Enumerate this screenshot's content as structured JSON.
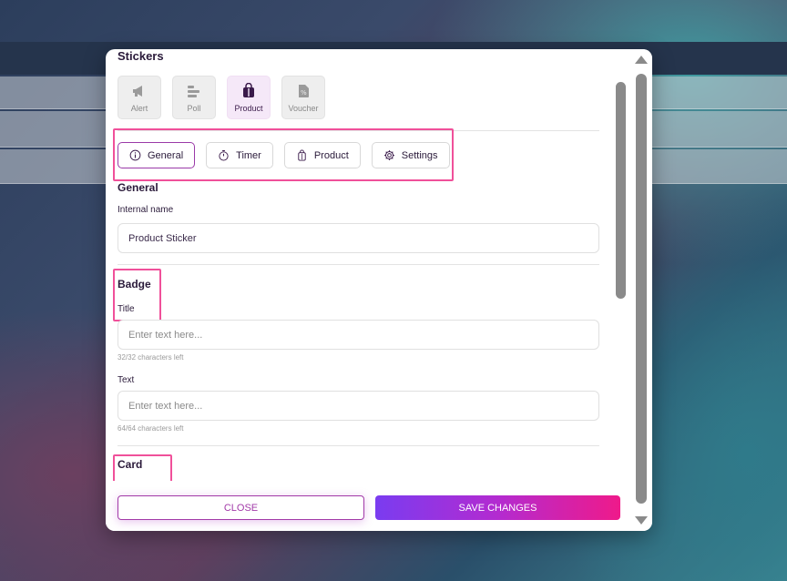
{
  "dialog": {
    "title": "Stickers"
  },
  "sticker_types": [
    {
      "label": "Alert",
      "icon": "megaphone-icon"
    },
    {
      "label": "Poll",
      "icon": "poll-bars-icon"
    },
    {
      "label": "Product",
      "icon": "shopping-bag-icon",
      "active": true
    },
    {
      "label": "Voucher",
      "icon": "voucher-icon"
    }
  ],
  "tabs": [
    {
      "label": "General",
      "icon": "info-icon",
      "active": true
    },
    {
      "label": "Timer",
      "icon": "stopwatch-icon"
    },
    {
      "label": "Product",
      "icon": "product-bag-icon"
    },
    {
      "label": "Settings",
      "icon": "gear-icon"
    }
  ],
  "general": {
    "heading": "General",
    "internal_name_label": "Internal name",
    "internal_name_value": "Product Sticker"
  },
  "badge": {
    "heading": "Badge",
    "title_label": "Title",
    "title_placeholder": "Enter text here...",
    "title_hint": "32/32 characters left",
    "text_label": "Text",
    "text_placeholder": "Enter text here...",
    "text_hint": "64/64 characters left"
  },
  "card": {
    "heading": "Card"
  },
  "footer": {
    "close_label": "CLOSE",
    "save_label": "SAVE CHANGES"
  },
  "colors": {
    "accent": "#a23aa8",
    "highlight": "#f0509a",
    "gradient_start": "#7a3cf0",
    "gradient_end": "#ef1a8a"
  }
}
